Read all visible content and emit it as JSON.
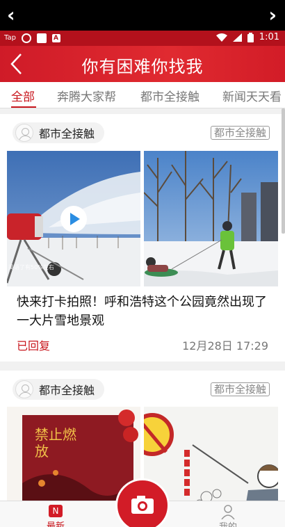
{
  "topbar": {
    "back_glyph": "‹",
    "forward_glyph": "›"
  },
  "statusbar": {
    "carrier": "Tap",
    "time": "1:01"
  },
  "header": {
    "title": "你有困难你找我"
  },
  "tabs": [
    {
      "label": "全部",
      "active": true
    },
    {
      "label": "奔腾大家帮",
      "active": false
    },
    {
      "label": "都市全接触",
      "active": false
    },
    {
      "label": "新闻天天看",
      "active": false
    }
  ],
  "posts": [
    {
      "author": "都市全接触",
      "tag": "都市全接触",
      "image_caption": "英语了有50%左右",
      "headline": "快来打卡拍照！呼和浩特这个公园竟然出现了一大片雪地景观",
      "status": "已回复",
      "time": "12月28日 17:29"
    },
    {
      "author": "都市全接触",
      "tag": "都市全接触",
      "poster_text": "禁止燃放"
    }
  ],
  "bottom_nav": {
    "home_badge": "N",
    "home_label": "最新",
    "me_label": "我的"
  },
  "colors": {
    "brand_red": "#c8161d",
    "header_red": "#d21c27"
  },
  "icons": [
    "back-arrow-icon",
    "forward-arrow-icon",
    "wifi-icon",
    "signal-icon",
    "battery-icon",
    "play-icon",
    "camera-icon",
    "user-icon"
  ]
}
